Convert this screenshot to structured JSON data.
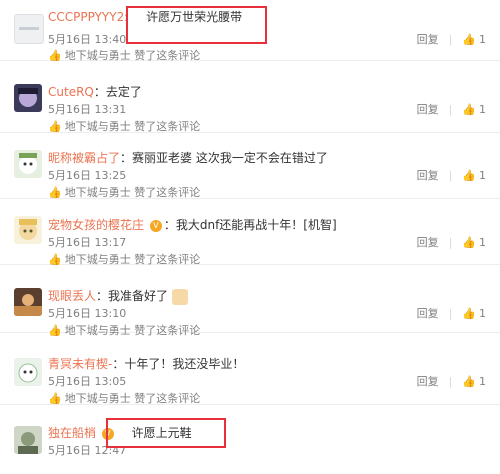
{
  "common": {
    "reply": "回复",
    "sep": "|",
    "thumb": "👍",
    "liked_by": "地下城与勇士 赞了这条评论"
  },
  "comments": [
    {
      "user": "CCCPPPYYY2",
      "colon": ":",
      "text": "许愿万世荣光腰带",
      "time": "5月16日 13:40",
      "likes": "1"
    },
    {
      "user": "CuteRQ",
      "colon": "：",
      "text": "去定了",
      "time": "5月16日 13:31",
      "likes": "1"
    },
    {
      "user": "昵称被霸占了",
      "colon": "：",
      "text": "赛丽亚老婆 这次我一定不会在错过了",
      "time": "5月16日 13:25",
      "likes": "1"
    },
    {
      "user": "宠物女孩的樱花庄",
      "colon": "：",
      "text": "我大dnf还能再战十年！[机智]",
      "time": "5月16日 13:17",
      "likes": "1"
    },
    {
      "user": "现眼丢人",
      "colon": "：",
      "text": "我准备好了",
      "time": "5月16日 13:10",
      "likes": "1"
    },
    {
      "user": "青冥未有楔-",
      "colon": "：",
      "text": "十年了！我还没毕业！",
      "time": "5月16日 13:05",
      "likes": "1"
    },
    {
      "user": "独在船梢",
      "colon": "：",
      "text": "许愿上元鞋",
      "time": "5月16日 12:47",
      "likes": ""
    }
  ]
}
